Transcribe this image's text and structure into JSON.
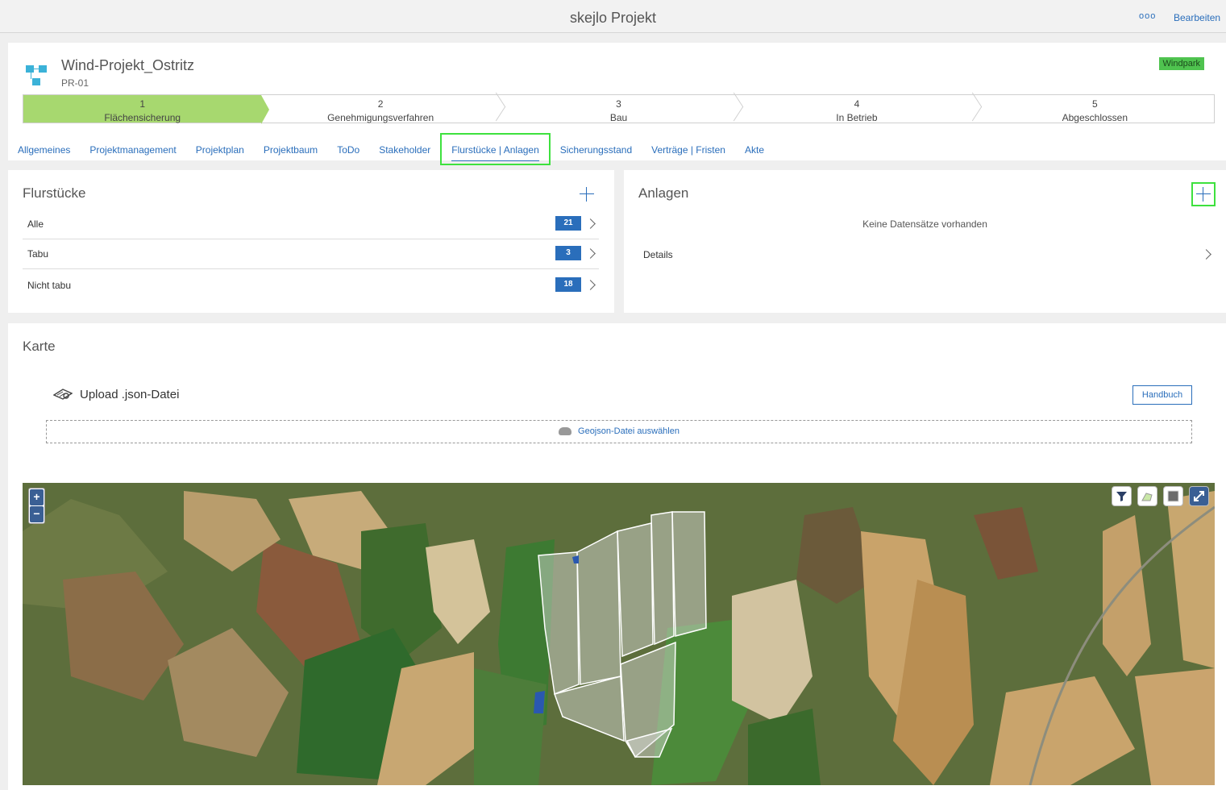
{
  "app": {
    "title": "skejlo Projekt",
    "more_label": "ooo",
    "edit_label": "Bearbeiten"
  },
  "project": {
    "name": "Wind-Projekt_Ostritz",
    "code": "PR-01",
    "tag": "Windpark",
    "tag_color": "#4fc34f"
  },
  "steps": [
    {
      "num": "1",
      "label": "Flächensicherung",
      "active": true
    },
    {
      "num": "2",
      "label": "Genehmigungsverfahren"
    },
    {
      "num": "3",
      "label": "Bau"
    },
    {
      "num": "4",
      "label": "In Betrieb"
    },
    {
      "num": "5",
      "label": "Abgeschlossen"
    }
  ],
  "tabs": [
    {
      "label": "Allgemeines"
    },
    {
      "label": "Projektmanagement"
    },
    {
      "label": "Projektplan"
    },
    {
      "label": "Projektbaum"
    },
    {
      "label": "ToDo"
    },
    {
      "label": "Stakeholder"
    },
    {
      "label": "Flurstücke | Anlagen",
      "active": true
    },
    {
      "label": "Sicherungsstand"
    },
    {
      "label": "Verträge | Fristen"
    },
    {
      "label": "Akte"
    }
  ],
  "flurstuecke": {
    "title": "Flurstücke",
    "rows": [
      {
        "label": "Alle",
        "count": "21"
      },
      {
        "label": "Tabu",
        "count": "3"
      },
      {
        "label": "Nicht tabu",
        "count": "18"
      }
    ]
  },
  "anlagen": {
    "title": "Anlagen",
    "empty_text": "Keine Datensätze vorhanden",
    "details_label": "Details"
  },
  "karte": {
    "title": "Karte",
    "upload_label": "Upload .json-Datei",
    "manual_label": "Handbuch",
    "dropzone_label": "Geojson-Datei auswählen",
    "zoom_in": "+",
    "zoom_out": "−"
  },
  "colors": {
    "accent": "#2a6ebb",
    "highlight": "#3ee13e",
    "step_active": "#a7d86f"
  }
}
